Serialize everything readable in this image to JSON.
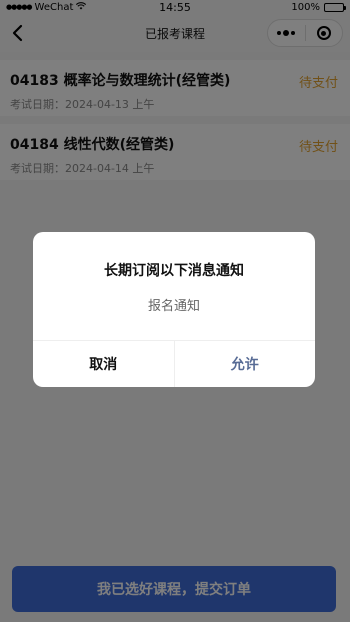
{
  "status_bar": {
    "carrier": "WeChat",
    "time": "14:55",
    "battery": "100%"
  },
  "nav": {
    "title": "已报考课程"
  },
  "courses": [
    {
      "name": "04183 概率论与数理统计(经管类)",
      "status": "待支付",
      "date": "考试日期：2024-04-13  上午"
    },
    {
      "name": "04184 线性代数(经管类)",
      "status": "待支付",
      "date": "考试日期：2024-04-14  上午"
    }
  ],
  "submit_label": "我已选好课程，提交订单",
  "dialog": {
    "title": "长期订阅以下消息通知",
    "body": "报名通知",
    "cancel_label": "取消",
    "allow_label": "允许"
  },
  "colors": {
    "accent": "#3e6dd8",
    "status_pending": "#e3a331",
    "allow_link": "#576b95"
  },
  "icons": {
    "back": "chevron-left-icon",
    "more": "more-dots-icon",
    "close": "capsule-close-icon",
    "wifi": "wifi-icon",
    "signal": "signal-icon",
    "battery": "battery-icon"
  }
}
